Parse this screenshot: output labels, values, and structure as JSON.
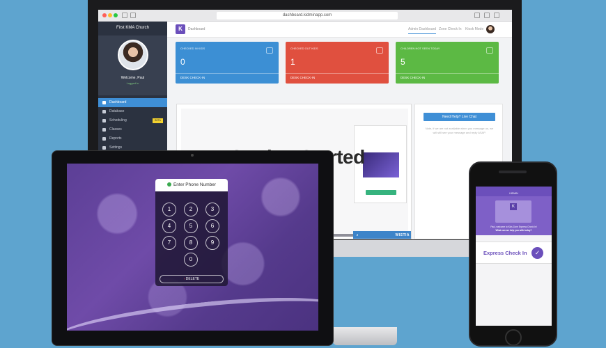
{
  "browser": {
    "url": "dashboard.kidminapp.com"
  },
  "sidebar": {
    "church": "First KMA Church",
    "welcome": "Welcome, Paul",
    "status": "Logged In",
    "items": [
      {
        "label": "Dashboard",
        "icon": "home-icon"
      },
      {
        "label": "Database",
        "icon": "user-icon"
      },
      {
        "label": "Scheduling",
        "icon": "shield-icon",
        "badge": "BETA"
      },
      {
        "label": "Classes",
        "icon": "clock-icon"
      },
      {
        "label": "Reports",
        "icon": "history-icon"
      },
      {
        "label": "Settings",
        "icon": "gear-icon"
      }
    ]
  },
  "topbar": {
    "logo_letter": "K",
    "crumb": "Dashboard",
    "links": [
      "Admin Dashboard",
      "Zone Check In",
      "Kiosk Mode"
    ]
  },
  "cards": [
    {
      "title": "Checked in kids",
      "value": "0",
      "link": "DESK CHECK-IN",
      "color": "#3c8fd4"
    },
    {
      "title": "Checked out kids",
      "value": "1",
      "link": "DESK CHECK-IN",
      "color": "#e0503f"
    },
    {
      "title": "Children not seen today",
      "value": "5",
      "link": "DESK CHECK-IN",
      "color": "#5cb944"
    }
  ],
  "video": {
    "title": "Getting Started",
    "brand": "WISTIA"
  },
  "help": {
    "button": "Need Help? Live Chat",
    "note": "Note, if we are not available when you message us, we will still see your message and reply ASAP."
  },
  "tablet": {
    "header": "Enter Phone Number",
    "keys": [
      "1",
      "2",
      "3",
      "4",
      "5",
      "6",
      "7",
      "8",
      "9",
      "0"
    ],
    "delete": "DELETE"
  },
  "phone": {
    "app_title": "KIDMIN",
    "logo_letter": "K",
    "message_line1": "Paul, welcome to Kids Zone Express Check In!",
    "message_line2": "What can we help you with today?",
    "express": "Express Check In"
  }
}
